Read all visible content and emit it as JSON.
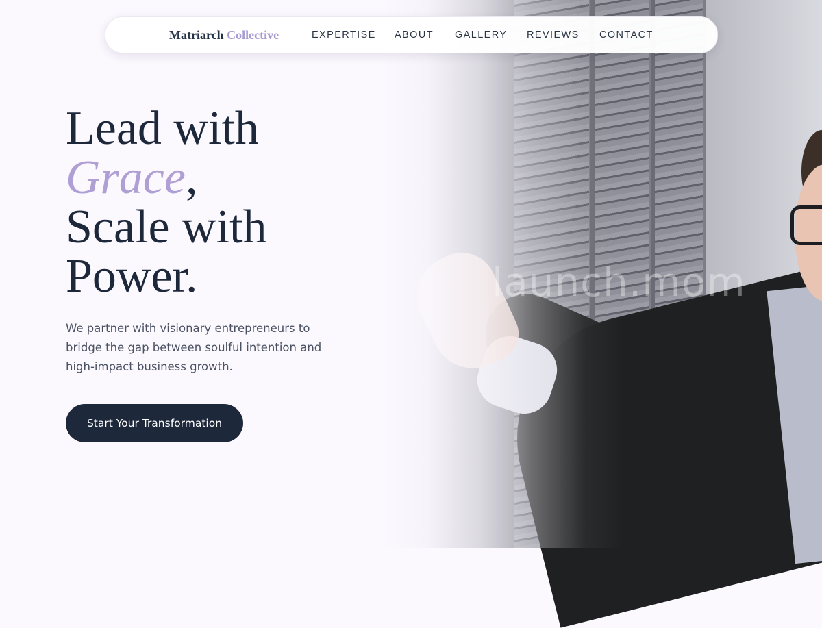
{
  "brand": {
    "name_primary": "Matriarch",
    "name_accent": "Collective"
  },
  "nav": {
    "items": [
      {
        "label": "EXPERTISE"
      },
      {
        "label": "ABOUT"
      },
      {
        "label": "GALLERY"
      },
      {
        "label": "REVIEWS"
      },
      {
        "label": "CONTACT"
      }
    ]
  },
  "hero": {
    "headline_line1": "Lead with",
    "headline_accent": "Grace",
    "headline_comma": ",",
    "headline_line3": "Scale with",
    "headline_line4": "Power.",
    "subtext": "We partner with visionary entrepreneurs to bridge the gap between soulful intention and high-impact business growth.",
    "cta_label": "Start Your Transformation"
  },
  "photo": {
    "watermark": "launch.mom"
  },
  "colors": {
    "accent": "#b09fd5",
    "dark": "#1e283b",
    "background": "#fbf8fe"
  }
}
